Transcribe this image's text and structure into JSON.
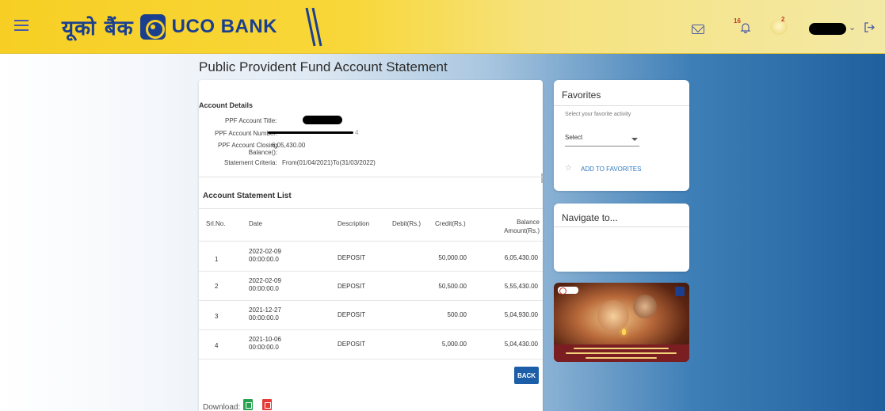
{
  "header": {
    "logo_hindi": "यूको बैंक",
    "logo_english": "UCO BANK",
    "notification_count": "16",
    "avatar_count": "2"
  },
  "page": {
    "title": "Public Provident Fund Account Statement"
  },
  "account_details": {
    "heading": "Account Details",
    "title_label": "PPF Account Title:",
    "number_label": "PPF Account Number:",
    "number_suffix": "4",
    "balance_label_line1": "PPF Account Closing",
    "balance_label_line2": "Balance():",
    "balance_value": "6,05,430.00",
    "criteria_label": "Statement Criteria:",
    "criteria_value": "From(01/04/2021)To(31/03/2022)"
  },
  "statement": {
    "heading": "Account Statement List",
    "columns": {
      "srl": "Srl.No.",
      "date": "Date",
      "description": "Description",
      "debit": "Debit(Rs.)",
      "credit": "Credit(Rs.)",
      "balance_line1": "Balance",
      "balance_line2": "Amount(Rs.)"
    },
    "rows": [
      {
        "srl": "1",
        "date_line1": "2022-02-09",
        "date_line2": "00:00:00.0",
        "description": "DEPOSIT",
        "debit": "",
        "credit": "50,000.00",
        "balance": "6,05,430.00"
      },
      {
        "srl": "2",
        "date_line1": "2022-02-09",
        "date_line2": "00:00:00.0",
        "description": "DEPOSIT",
        "debit": "",
        "credit": "50,500.00",
        "balance": "5,55,430.00"
      },
      {
        "srl": "3",
        "date_line1": "2021-12-27",
        "date_line2": "00:00:00.0",
        "description": "DEPOSIT",
        "debit": "",
        "credit": "500.00",
        "balance": "5,04,930.00"
      },
      {
        "srl": "4",
        "date_line1": "2021-10-06",
        "date_line2": "00:00:00.0",
        "description": "DEPOSIT",
        "debit": "",
        "credit": "5,000.00",
        "balance": "5,04,430.00"
      }
    ],
    "back_label": "BACK",
    "download_label": "Download:"
  },
  "favorites": {
    "title": "Favorites",
    "hint": "Select your favorite activity",
    "select_value": "Select",
    "add_label": "ADD TO FAVORITES"
  },
  "navigate": {
    "title": "Navigate to..."
  },
  "colors": {
    "header_yellow": "#f7cf24",
    "brand_blue": "#1b3f8f",
    "button_blue": "#1d5ea8",
    "link_blue": "#2f7bc2"
  }
}
